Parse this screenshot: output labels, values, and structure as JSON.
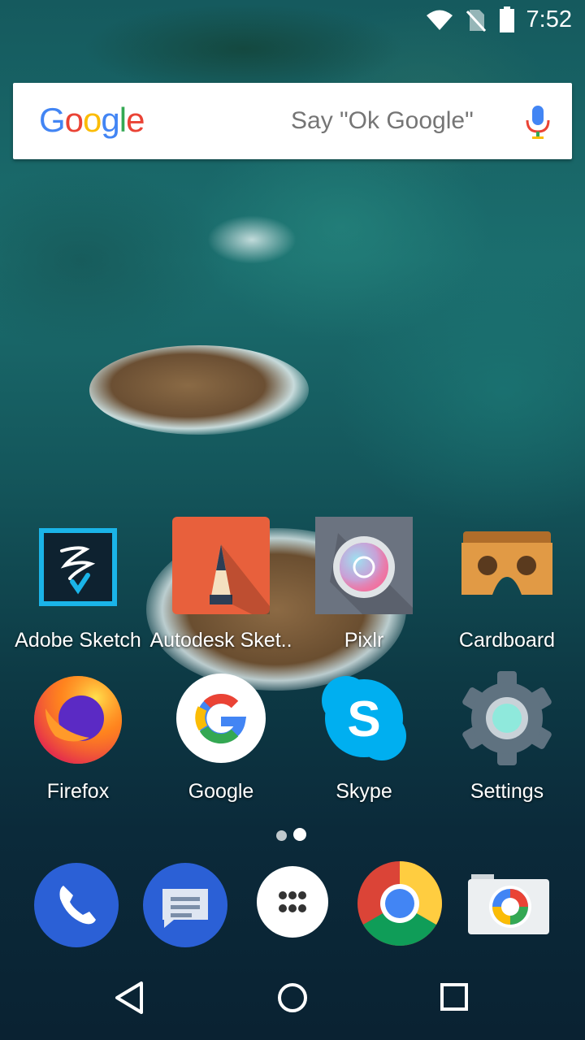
{
  "status_bar": {
    "time": "7:52",
    "icons": [
      "wifi-icon",
      "no-sim-icon",
      "battery-icon"
    ]
  },
  "search_widget": {
    "logo_text": "Google",
    "hint": "Say \"Ok Google\"",
    "mic_icon": "mic-icon"
  },
  "apps": [
    {
      "label": "Adobe Sketch",
      "icon": "adobe-sketch-icon"
    },
    {
      "label": "Autodesk Sket..",
      "icon": "autodesk-sketchbook-icon"
    },
    {
      "label": "Pixlr",
      "icon": "pixlr-icon"
    },
    {
      "label": "Cardboard",
      "icon": "cardboard-icon"
    },
    {
      "label": "Firefox",
      "icon": "firefox-icon"
    },
    {
      "label": "Google",
      "icon": "google-icon"
    },
    {
      "label": "Skype",
      "icon": "skype-icon"
    },
    {
      "label": "Settings",
      "icon": "settings-icon"
    }
  ],
  "page_indicator": {
    "pages": 2,
    "current": 2
  },
  "dock": [
    "phone-icon",
    "messages-icon",
    "app-drawer-icon",
    "chrome-icon",
    "camera-icon"
  ],
  "nav_bar": [
    "back-icon",
    "home-icon",
    "recents-icon"
  ],
  "colors": {
    "google_blue": "#4285F4",
    "google_red": "#EA4335",
    "google_yellow": "#FBBC05",
    "google_green": "#34A853"
  }
}
